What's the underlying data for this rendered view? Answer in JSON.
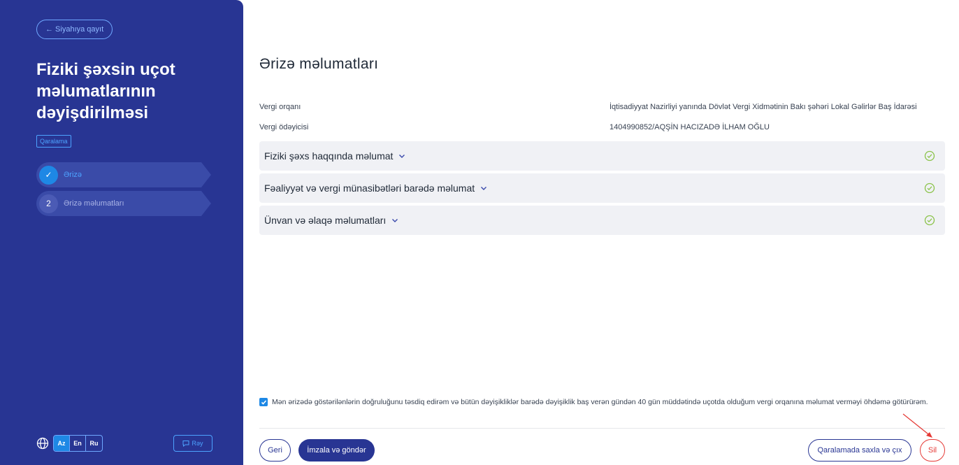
{
  "sidebar": {
    "back_label": "← Siyahıya qayıt",
    "title": "Fiziki şəxsin uçot məlumatlarının dəyişdirilməsi",
    "status_badge": "Qaralama",
    "steps": [
      {
        "marker": "✓",
        "label": "Ərizə"
      },
      {
        "marker": "2",
        "label": "Ərizə məlumatları"
      }
    ],
    "languages": [
      "Az",
      "En",
      "Ru"
    ],
    "active_language": "Az",
    "feedback_label": "Rəy"
  },
  "main": {
    "title": "Ərizə məlumatları",
    "info": [
      {
        "label": "Vergi orqanı",
        "value": "İqtisadiyyat Nazirliyi yanında Dövlət Vergi Xidmətinin Bakı şəhəri Lokal Gəlirlər Baş İdarəsi"
      },
      {
        "label": "Vergi ödəyicisi",
        "value": "1404990852/AQŞİN HACIZADƏ İLHAM OĞLU"
      }
    ],
    "sections": [
      {
        "label": "Fiziki şəxs haqqında məlumat"
      },
      {
        "label": "Fəaliyyət və vergi münasibətləri barədə məlumat"
      },
      {
        "label": "Ünvan və əlaqə məlumatları"
      }
    ],
    "confirmation_text": "Mən ərizədə göstərilənlərin doğruluğunu təsdiq edirəm və bütün dəyişikliklər barədə dəyişiklik baş verən gündən 40 gün müddətində uçotda olduğum vergi orqanına məlumat verməyi öhdəmə götürürəm.",
    "confirmation_checked": true,
    "buttons": {
      "back": "Geri",
      "sign_send": "İmzala və göndər",
      "save_exit": "Qaralamada saxla və çıx",
      "delete": "Sil"
    }
  },
  "colors": {
    "sidebar_bg": "#283593",
    "accent": "#1e88e5",
    "success": "#8bc34a",
    "danger": "#e53935"
  },
  "icons": {
    "globe": "globe-icon",
    "feedback": "comment-icon",
    "check": "check-circle-icon",
    "chevron": "chevron-down-icon"
  }
}
